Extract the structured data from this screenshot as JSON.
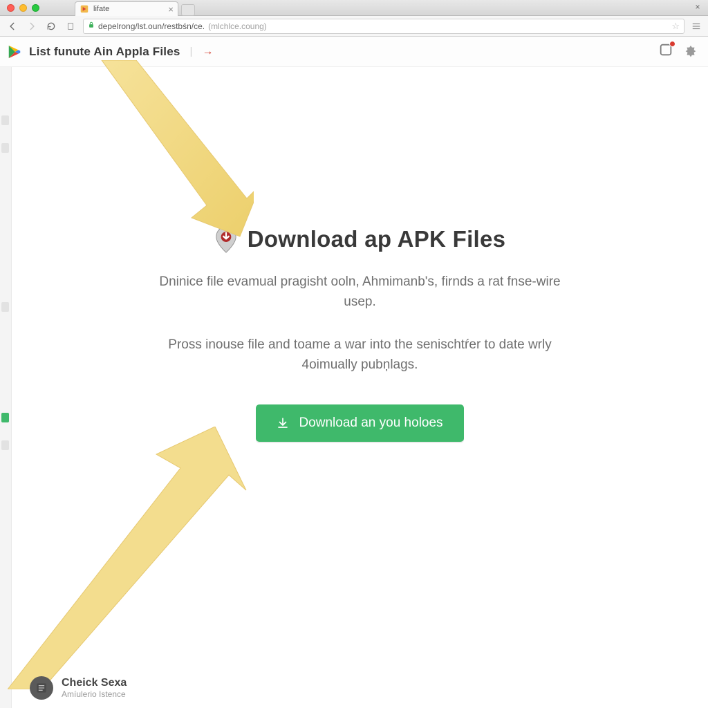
{
  "tab": {
    "title": "lifate"
  },
  "address": {
    "url_main": "depelrong/lst.oun/restbśn/ce.",
    "url_rest": "(mlchlce.coung)"
  },
  "header": {
    "title": "List funute Ain Appla Files",
    "sep": "|",
    "arrow": "→"
  },
  "hero": {
    "title": "Download ap APK Files",
    "p1": "Dninice file evamual pragisht ooln, Ahmimanb's, firnds a rat fnse-wire usep.",
    "p2": "Pross inouse file and toame a war into the senischtŕer to date wrly 4oimually pubņlags."
  },
  "button": {
    "label": "Download an you holoes"
  },
  "footer": {
    "name": "Cheick Sexa",
    "sub": "Amíulerio Istence"
  },
  "colors": {
    "green": "#3fb96b",
    "red": "#d23a2a"
  }
}
